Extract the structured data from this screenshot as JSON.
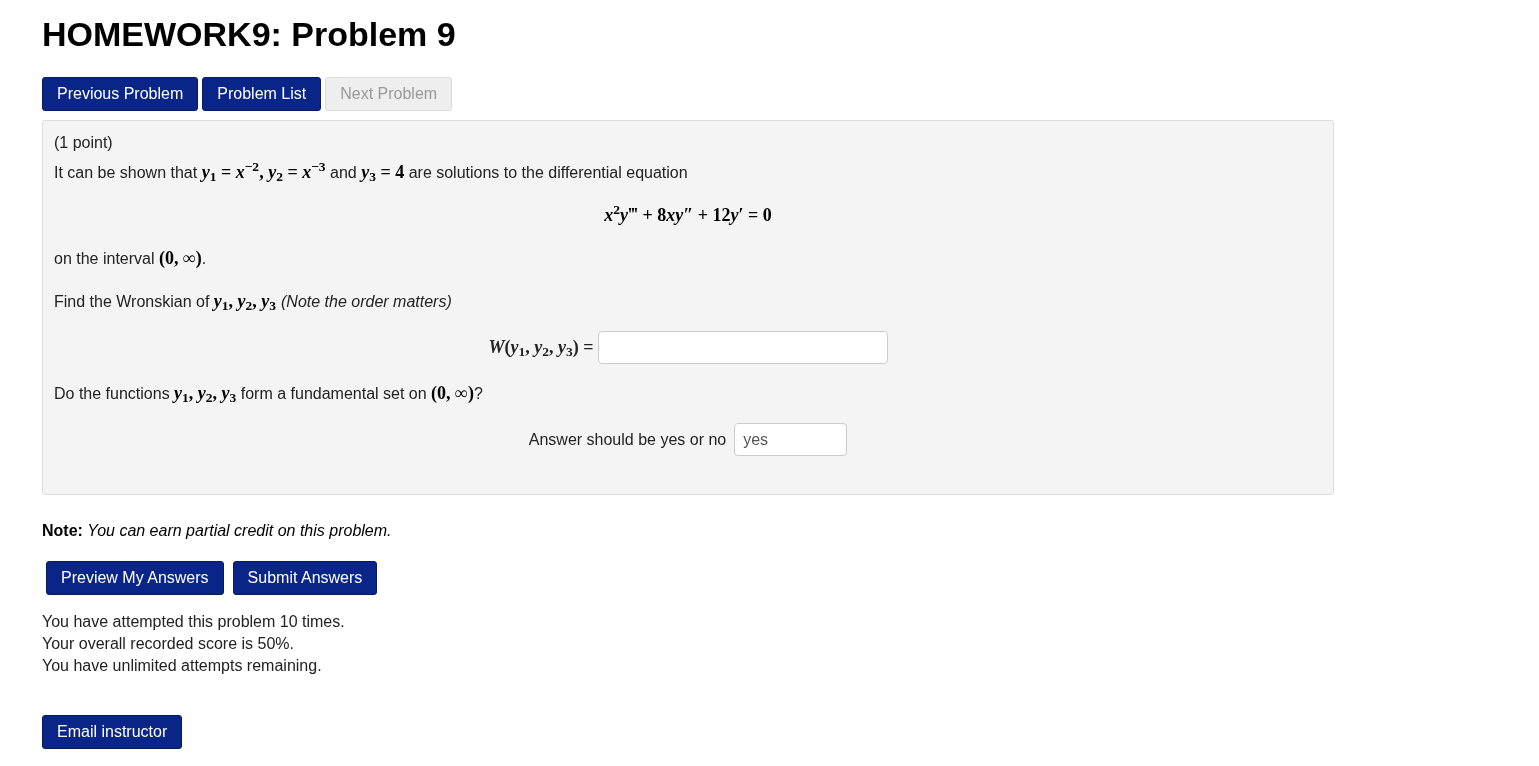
{
  "title": "HOMEWORK9: Problem 9",
  "nav_buttons": [
    {
      "label": "Previous Problem",
      "disabled": false
    },
    {
      "label": "Problem List",
      "disabled": false
    },
    {
      "label": "Next Problem",
      "disabled": true
    }
  ],
  "problem": {
    "points": "(1 point)",
    "blocks": [
      {
        "kind": "para",
        "parts": [
          {
            "kind": "text",
            "text": "It can be shown that "
          },
          {
            "kind": "math",
            "text": "*y*$_{1}$ = *x*$^{−2}$, *y*$_{2}$ = *x*$^{−3}$"
          },
          {
            "kind": "text",
            "text": " and "
          },
          {
            "kind": "math",
            "text": "*y*$_{3}$ = 4"
          },
          {
            "kind": "text",
            "text": " are solutions to the differential equation"
          }
        ]
      },
      {
        "kind": "display",
        "parts": [
          {
            "kind": "math",
            "text": "*x*$^{2}$*y*‴ + 8"
          },
          {
            "kind": "math",
            "text": "*xy*″ + 12"
          },
          {
            "kind": "math",
            "text": "*y*′ = 0"
          }
        ]
      },
      {
        "kind": "para",
        "parts": [
          {
            "kind": "text",
            "text": "on the interval "
          },
          {
            "kind": "math",
            "text": "(0, ∞)"
          },
          {
            "kind": "text",
            "text": "."
          }
        ]
      },
      {
        "kind": "para",
        "parts": [
          {
            "kind": "text",
            "text": "Find the Wronskian of "
          },
          {
            "kind": "math",
            "text": "*y*$_{1}$, *y*$_{2}$, *y*$_{3}$"
          },
          {
            "kind": "italic",
            "text": "(Note the order matters)"
          }
        ]
      },
      {
        "kind": "math_answer",
        "label": "*W*(*y*$_{1}$, *y*$_{2}$, *y*$_{3}$) ="
      },
      {
        "kind": "para",
        "parts": [
          {
            "kind": "text",
            "text": "Do the functions "
          },
          {
            "kind": "math",
            "text": "*y*$_{1}$, *y*$_{2}$, *y*$_{3}$"
          },
          {
            "kind": "text",
            "text": " form a fundamental set on "
          },
          {
            "kind": "math",
            "text": "(0, ∞)"
          },
          {
            "kind": "text",
            "text": "?"
          }
        ]
      },
      {
        "kind": "text_answer",
        "label": "Answer should be yes or no",
        "value": "yes"
      }
    ]
  },
  "note": "**Note:** *You can earn partial credit on this problem.*",
  "submit_buttons": [
    "Preview My Answers",
    "Submit Answers"
  ],
  "status_lines": [
    "You have attempted this problem 10 times.",
    "Your overall recorded score is 50%.",
    "You have unlimited attempts remaining."
  ],
  "email_button": "Email instructor"
}
